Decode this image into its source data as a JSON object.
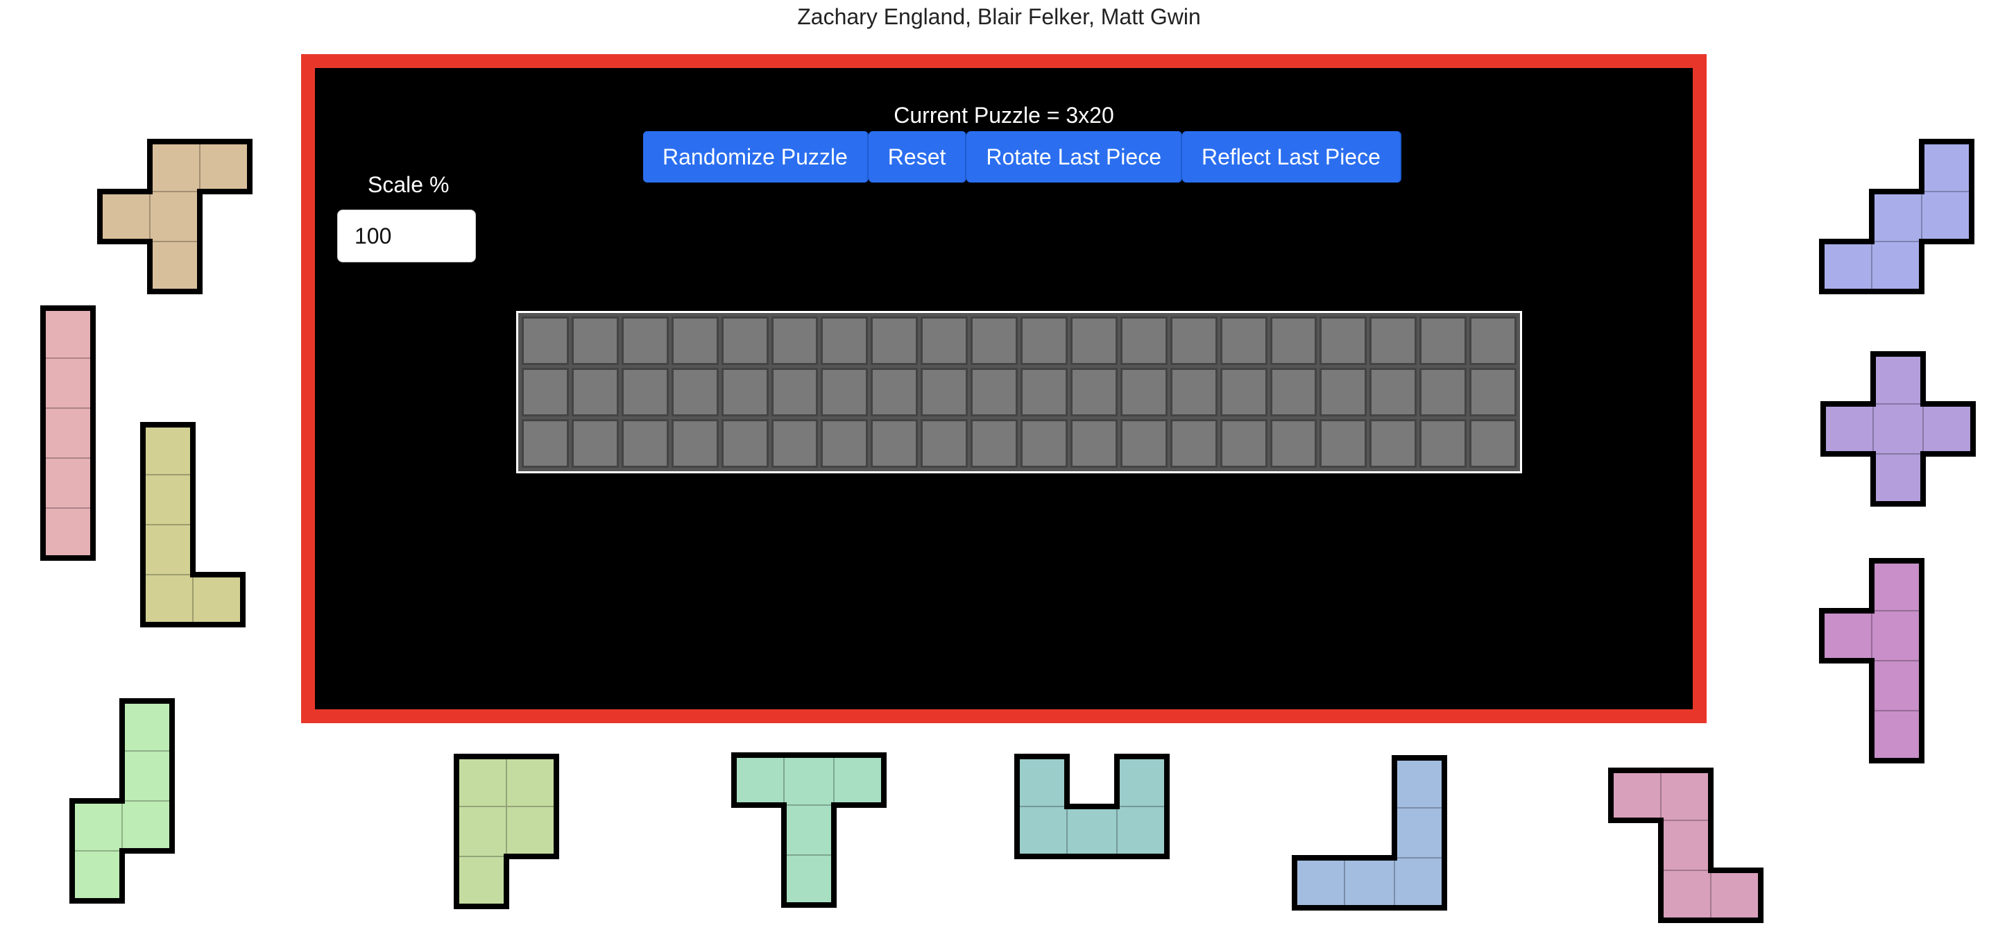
{
  "header": {
    "credits": "Zachary England, Blair Felker, Matt Gwin"
  },
  "puzzle": {
    "title": "Current Puzzle = 3x20",
    "rows": 3,
    "cols": 20
  },
  "toolbar": {
    "randomize_label": "Randomize Puzzle",
    "reset_label": "Reset",
    "rotate_label": "Rotate Last Piece",
    "reflect_label": "Reflect Last Piece"
  },
  "scale": {
    "label": "Scale %",
    "value": "100"
  },
  "colors": {
    "frame": "#e8372a",
    "button": "#2b6ff0",
    "board_cell": "#7a7a7a"
  },
  "pieces": [
    {
      "id": "tan-f",
      "color": "#d8bf9b",
      "cells": [
        [
          1,
          0
        ],
        [
          2,
          0
        ],
        [
          0,
          1
        ],
        [
          1,
          1
        ],
        [
          1,
          2
        ]
      ]
    },
    {
      "id": "pink-i",
      "color": "#e6b1b5",
      "cells": [
        [
          0,
          0
        ],
        [
          0,
          1
        ],
        [
          0,
          2
        ],
        [
          0,
          3
        ],
        [
          0,
          4
        ]
      ]
    },
    {
      "id": "olive-l",
      "color": "#d2d093",
      "cells": [
        [
          0,
          0
        ],
        [
          0,
          1
        ],
        [
          0,
          2
        ],
        [
          0,
          3
        ],
        [
          1,
          3
        ]
      ]
    },
    {
      "id": "green-n",
      "color": "#bdecb4",
      "cells": [
        [
          1,
          0
        ],
        [
          1,
          1
        ],
        [
          0,
          2
        ],
        [
          1,
          2
        ],
        [
          0,
          3
        ]
      ]
    },
    {
      "id": "lime-p",
      "color": "#c5dca1",
      "cells": [
        [
          0,
          0
        ],
        [
          1,
          0
        ],
        [
          0,
          1
        ],
        [
          1,
          1
        ],
        [
          0,
          2
        ]
      ]
    },
    {
      "id": "mint-t",
      "color": "#a8dfc2",
      "cells": [
        [
          0,
          0
        ],
        [
          1,
          0
        ],
        [
          2,
          0
        ],
        [
          1,
          1
        ],
        [
          1,
          2
        ]
      ]
    },
    {
      "id": "teal-u",
      "color": "#9bcdcb",
      "cells": [
        [
          0,
          0
        ],
        [
          2,
          0
        ],
        [
          0,
          1
        ],
        [
          1,
          1
        ],
        [
          2,
          1
        ]
      ]
    },
    {
      "id": "blue-v",
      "color": "#a3bde0",
      "cells": [
        [
          2,
          0
        ],
        [
          2,
          1
        ],
        [
          0,
          2
        ],
        [
          1,
          2
        ],
        [
          2,
          2
        ]
      ]
    },
    {
      "id": "rose-z",
      "color": "#d9a0bb",
      "cells": [
        [
          0,
          0
        ],
        [
          1,
          0
        ],
        [
          1,
          1
        ],
        [
          1,
          2
        ],
        [
          2,
          2
        ]
      ]
    },
    {
      "id": "periw-w",
      "color": "#a9aeeb",
      "cells": [
        [
          2,
          0
        ],
        [
          1,
          1
        ],
        [
          2,
          1
        ],
        [
          0,
          2
        ],
        [
          1,
          2
        ]
      ]
    },
    {
      "id": "lilac-x",
      "color": "#b49fdc",
      "cells": [
        [
          1,
          0
        ],
        [
          0,
          1
        ],
        [
          1,
          1
        ],
        [
          2,
          1
        ],
        [
          1,
          2
        ]
      ]
    },
    {
      "id": "purple-y",
      "color": "#c88fc8",
      "cells": [
        [
          1,
          0
        ],
        [
          0,
          1
        ],
        [
          1,
          1
        ],
        [
          1,
          2
        ],
        [
          1,
          3
        ]
      ]
    }
  ]
}
